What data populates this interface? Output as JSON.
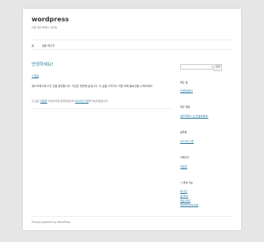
{
  "site": {
    "title": "wordpress",
    "description": "다른 워드프레스 사이트"
  },
  "nav": {
    "items": [
      {
        "label": "홈"
      },
      {
        "label": "샘플 페이지"
      }
    ]
  },
  "post": {
    "title": "안녕하세요!",
    "reply_link": "1 댓글",
    "body": "워드프레스에 오신 것을 환영합니다. 이것은 첫번째 글입니다. 이 글을 고치거나 지운 후에 블로깅을 시작하세요!",
    "meta_prefix": "이 글은",
    "meta_category": "미분류",
    "meta_middle": "카테고리에 분류되었으며",
    "meta_date": "2013년 2월",
    "meta_suffix": "에 작성되었습니다."
  },
  "search": {
    "placeholder": "",
    "button_label": "검색"
  },
  "sidebar": {
    "recent_posts": {
      "title": "최근 글",
      "items": [
        "안녕하세요!"
      ]
    },
    "recent_comments": {
      "title": "최근 댓글",
      "items": [
        "워드프레스 님 안녕하세요!"
      ]
    },
    "archives": {
      "title": "글목록",
      "items": [
        "2013년 2월"
      ]
    },
    "categories": {
      "title": "카테고리",
      "items": [
        "미분류"
      ]
    },
    "meta": {
      "title": "그 밖의 기능",
      "items": [
        "로그인",
        "글 RSS",
        "댓글 RSS",
        "WordPress.org"
      ]
    }
  },
  "footer": {
    "text": "Proudly powered by WordPress"
  }
}
